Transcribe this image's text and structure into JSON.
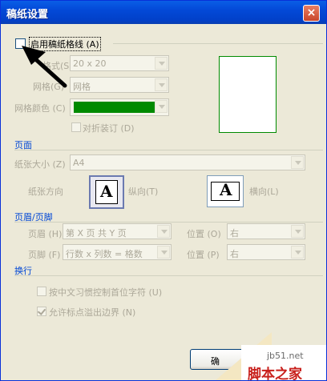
{
  "window": {
    "title": "稿纸设置",
    "close_glyph": "×"
  },
  "enable": {
    "label": "启用稿纸格线",
    "accel": "(A)",
    "checked": false
  },
  "grid": {
    "style_label": "格式",
    "style_accel": "(S)",
    "style_value": "20 x 20",
    "grid_label": "网格",
    "grid_accel": "(G)",
    "grid_value": "网格",
    "color_label": "网格颜色",
    "color_accel": "(C)",
    "color_value": "#008a00",
    "fold_label": "对折装订",
    "fold_accel": "(D)"
  },
  "page": {
    "section": "页面",
    "size_label": "纸张大小",
    "size_accel": "(Z)",
    "size_value": "A4",
    "orientation_label": "纸张方向",
    "portrait_label": "纵向",
    "portrait_accel": "(T)",
    "landscape_label": "横向",
    "landscape_accel": "(L)",
    "icon_letter": "A"
  },
  "header_footer": {
    "section": "页眉/页脚",
    "header_label": "页眉",
    "header_accel": "(H)",
    "header_value": "第 X 页 共 Y 页",
    "header_pos_label": "位置",
    "header_pos_accel": "(O)",
    "header_pos_value": "右",
    "footer_label": "页脚",
    "footer_accel": "(F)",
    "footer_value": "行数 x 列数 = 格数",
    "footer_pos_label": "位置",
    "footer_pos_accel": "(P)",
    "footer_pos_value": "右"
  },
  "linebreak": {
    "section": "换行",
    "opt1_label": "按中文习惯控制首位字符",
    "opt1_accel": "(U)",
    "opt1_checked": false,
    "opt2_label": "允许标点溢出边界",
    "opt2_accel": "(N)",
    "opt2_checked": true
  },
  "buttons": {
    "ok_label": "确"
  },
  "watermark": {
    "site": "jb51.net",
    "name": "脚本之家"
  }
}
